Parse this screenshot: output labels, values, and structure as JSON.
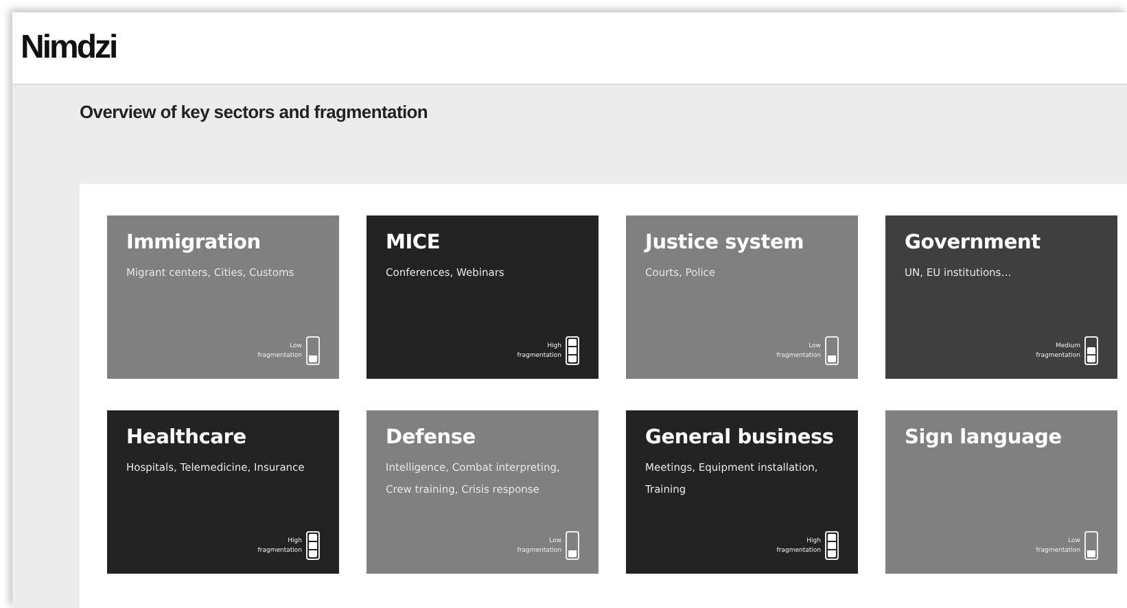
{
  "header": {
    "logo": "Nimdzi"
  },
  "page_title": "Overview of key sectors and fragmentation",
  "cards": [
    {
      "title": "Immigration",
      "subtitle": "Migrant centers, Cities, Customs",
      "color": "#808080",
      "meter_label": "Low",
      "meter_caption": "fragmentation",
      "level": 0.333
    },
    {
      "title": "MICE",
      "subtitle": "Conferences, Webinars",
      "color": "#232323",
      "meter_label": "High",
      "meter_caption": "fragmentation",
      "level": 1
    },
    {
      "title": "Justice system",
      "subtitle": "Courts, Police",
      "color": "#808080",
      "meter_label": "Low",
      "meter_caption": "fragmentation",
      "level": 0.333
    },
    {
      "title": "Government",
      "subtitle": "UN, EU institutions…",
      "color": "#3f3f3f",
      "meter_label": "Medium",
      "meter_caption": "fragmentation",
      "level": 0.667
    },
    {
      "title": "Healthcare",
      "subtitle": "Hospitals, Telemedicine, Insurance",
      "color": "#232323",
      "meter_label": "High",
      "meter_caption": "fragmentation",
      "level": 1
    },
    {
      "title": "Defense",
      "subtitle": "Intelligence, Combat interpreting, Crew training, Crisis response",
      "color": "#808080",
      "meter_label": "Low",
      "meter_caption": "fragmentation",
      "level": 0.333
    },
    {
      "title": "General business",
      "subtitle": "Meetings, Equipment installation, Training",
      "color": "#232323",
      "meter_label": "High",
      "meter_caption": "fragmentation",
      "level": 1
    },
    {
      "title": "Sign language",
      "color": "#808080",
      "meter_label": "Low",
      "meter_caption": "fragmentation",
      "level": 0.333
    }
  ]
}
